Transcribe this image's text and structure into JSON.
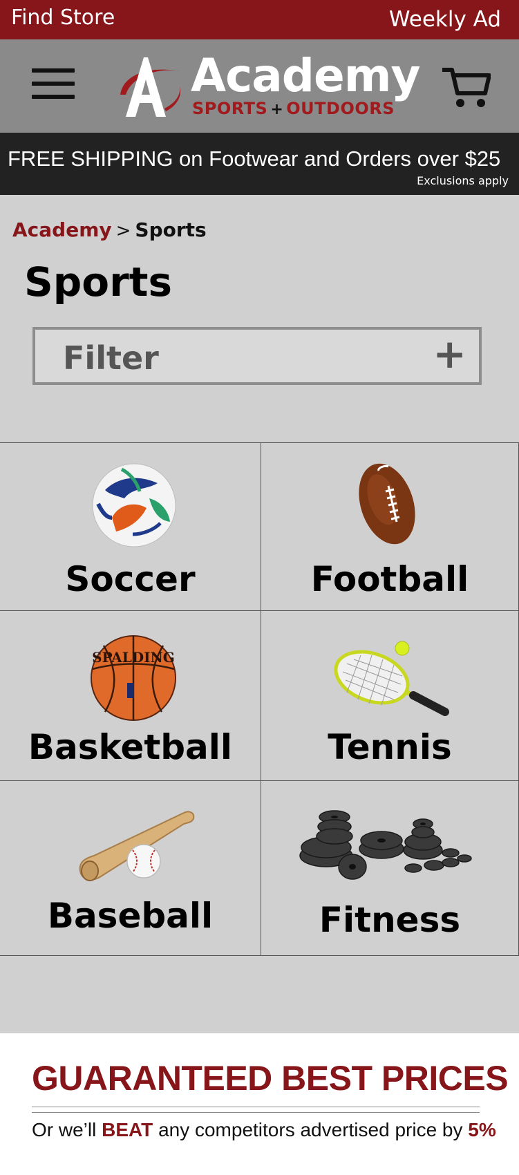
{
  "topbar": {
    "find_store": "Find Store",
    "weekly_ad": "Weekly Ad"
  },
  "header": {
    "logo_word": "Academy",
    "logo_tag_left": "SPORTS",
    "logo_tag_plus": "+",
    "logo_tag_right": "OUTDOORS"
  },
  "promo": {
    "text": "FREE SHIPPING on Footwear and Orders over $25",
    "note": "Exclusions apply"
  },
  "breadcrumb": {
    "home": "Academy",
    "separator": ">",
    "current": "Sports"
  },
  "page": {
    "title": "Sports"
  },
  "filter": {
    "label": "Filter",
    "toggle": "+"
  },
  "categories": [
    {
      "label": "Soccer",
      "icon": "soccer-ball-icon"
    },
    {
      "label": "Football",
      "icon": "football-icon"
    },
    {
      "label": "Basketball",
      "icon": "basketball-icon"
    },
    {
      "label": "Tennis",
      "icon": "tennis-racket-icon"
    },
    {
      "label": "Baseball",
      "icon": "baseball-bat-icon"
    },
    {
      "label": "Fitness",
      "icon": "weight-plates-icon"
    }
  ],
  "footer": {
    "headline": "GUARANTEED BEST PRICES",
    "sub_start": "Or we’ll",
    "sub_beat": "BEAT",
    "sub_middle": "any competitors advertised price by",
    "sub_pct": "5%"
  },
  "colors": {
    "brand_red": "#861619",
    "header_gray": "#8a8a8a",
    "promo_bg": "#222222",
    "page_bg": "#d0d0d0"
  }
}
